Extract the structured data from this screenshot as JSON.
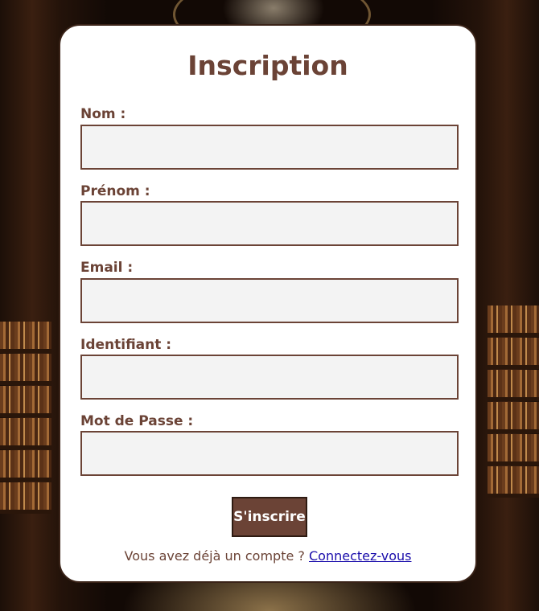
{
  "form": {
    "title": "Inscription",
    "fields": [
      {
        "label": "Nom :",
        "value": ""
      },
      {
        "label": "Prénom :",
        "value": ""
      },
      {
        "label": "Email :",
        "value": ""
      },
      {
        "label": "Identifiant :",
        "value": ""
      },
      {
        "label": "Mot de Passe :",
        "value": ""
      }
    ],
    "submit_label": "S'inscrire",
    "footer_text": "Vous avez déjà un compte ?",
    "footer_link": "Connectez-vous"
  },
  "colors": {
    "accent": "#6b4336",
    "input_background": "#f3f3f3",
    "card_background": "#ffffff",
    "link": "#1a0dab"
  }
}
